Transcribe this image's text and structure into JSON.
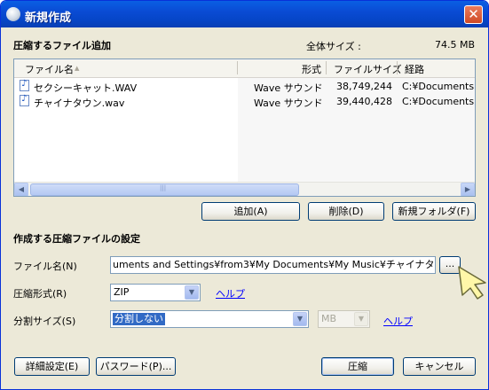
{
  "window": {
    "title": "新規作成",
    "close_label": "✕"
  },
  "add_section": {
    "header": "圧縮するファイル追加",
    "total_size_label": "全体サイズ :",
    "total_size_value": "74.5 MB"
  },
  "file_list": {
    "columns": {
      "name": "ファイル名",
      "sort_glyph": "▲",
      "format": "形式",
      "size": "ファイルサイズ",
      "path": "経路"
    },
    "rows": [
      {
        "name": "セクシーキャット.WAV",
        "format": "Wave サウンド",
        "size": "38,749,244",
        "path": "C:¥Documents a"
      },
      {
        "name": "チャイナタウン.wav",
        "format": "Wave サウンド",
        "size": "39,440,428",
        "path": "C:¥Documents a"
      }
    ]
  },
  "list_buttons": {
    "add": "追加(A)",
    "delete": "削除(D)",
    "new_folder": "新規フォルダ(F)"
  },
  "settings": {
    "header": "作成する圧縮ファイルの設定",
    "filename_label": "ファイル名(N)",
    "filename_value": "uments and Settings¥from3¥My Documents¥My Music¥チャイナタウン.zip",
    "browse_label": "...",
    "format_label": "圧縮形式(R)",
    "format_value": "ZIP",
    "split_label": "分割サイズ(S)",
    "split_value": "分割しない",
    "split_unit": "MB",
    "help": "ヘルプ"
  },
  "bottom_buttons": {
    "advanced": "詳細設定(E)",
    "password": "パスワード(P)...",
    "compress": "圧縮",
    "cancel": "キャンセル"
  },
  "colors": {
    "title_blue": "#0a5fe4",
    "face": "#ece9d8",
    "link": "#0000ff",
    "selection": "#316ac5"
  }
}
